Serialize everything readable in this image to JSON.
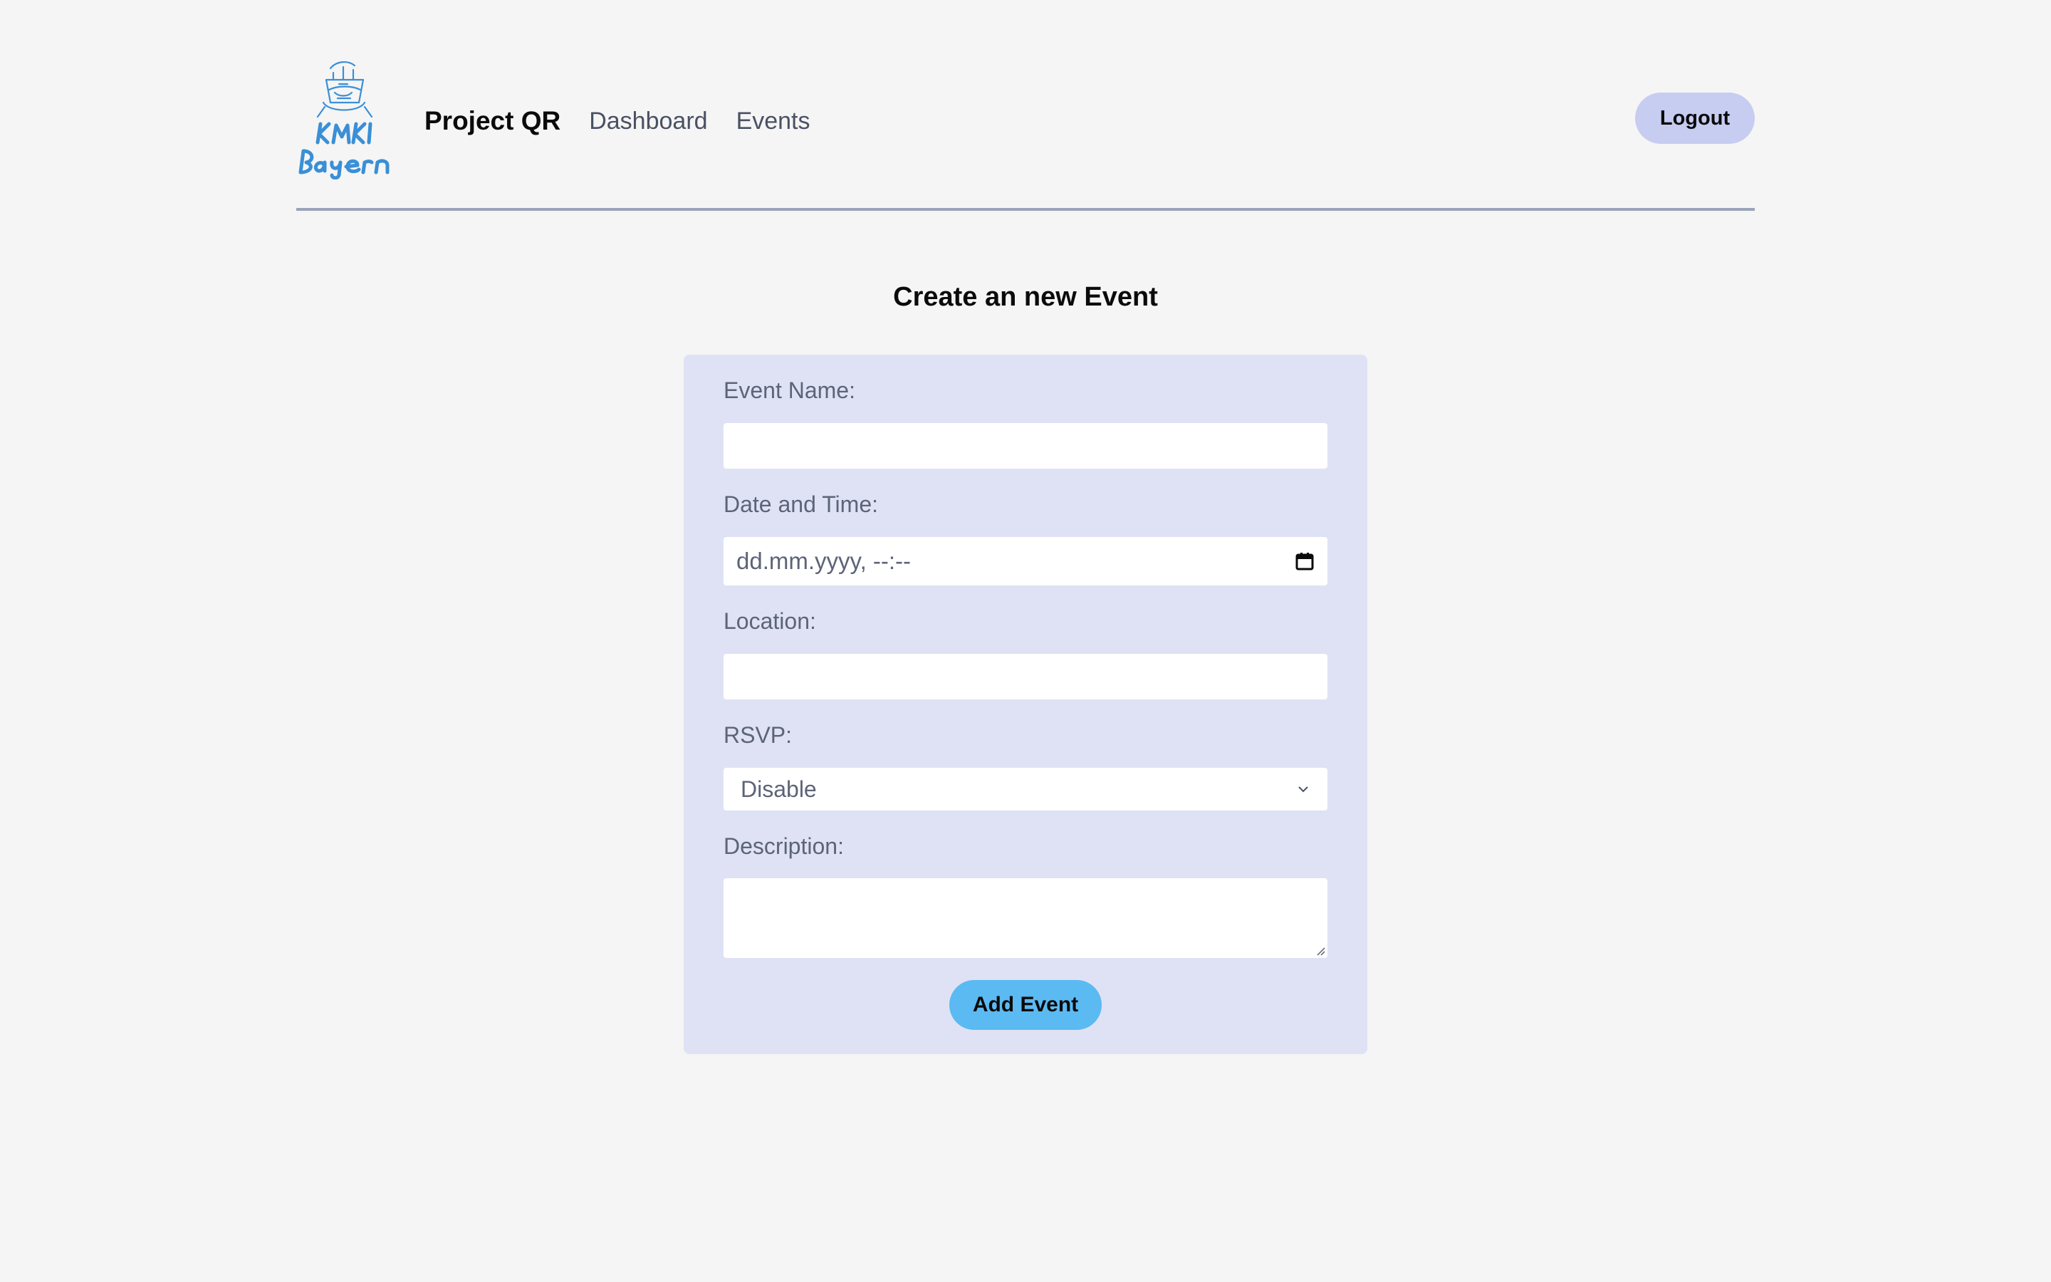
{
  "header": {
    "logo_text": "KMKI Bayern",
    "brand": "Project QR",
    "nav": [
      {
        "label": "Dashboard"
      },
      {
        "label": "Events"
      }
    ],
    "logout_label": "Logout"
  },
  "main": {
    "title": "Create an new Event",
    "form": {
      "event_name_label": "Event Name:",
      "event_name_value": "",
      "datetime_label": "Date and Time:",
      "datetime_placeholder": "dd.mm.yyyy, --:--",
      "location_label": "Location:",
      "location_value": "",
      "rsvp_label": "RSVP:",
      "rsvp_selected": "Disable",
      "description_label": "Description:",
      "description_value": "",
      "submit_label": "Add Event"
    }
  },
  "icons": {
    "logo": "kmki-bayern-logo",
    "calendar": "calendar-icon",
    "chevron": "chevron-down-icon",
    "resize": "resize-handle-icon"
  },
  "colors": {
    "background": "#f5f5f5",
    "card": "#dfe2f5",
    "logout_button": "#c7ccf1",
    "submit_button": "#5bbaf2",
    "logo_blue": "#3a8fd6",
    "divider": "#9aa3b8"
  }
}
